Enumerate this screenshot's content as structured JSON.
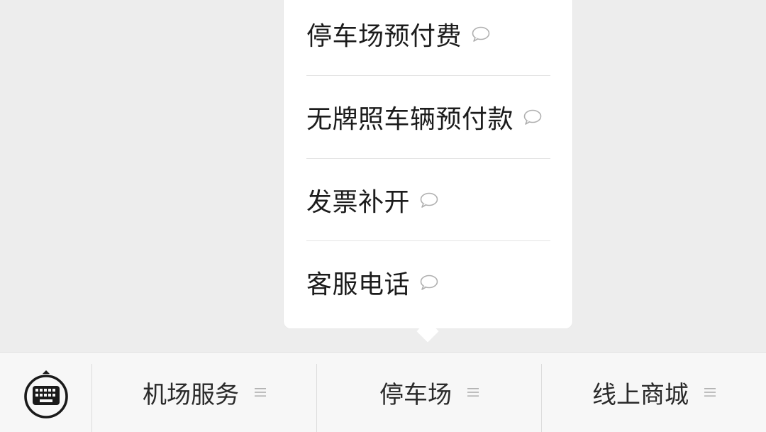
{
  "submenu": {
    "items": [
      {
        "label": "停车场预付费",
        "icon": "chat-bubble-icon"
      },
      {
        "label": "无牌照车辆预付款",
        "icon": "chat-bubble-icon"
      },
      {
        "label": "发票补开",
        "icon": "chat-bubble-icon"
      },
      {
        "label": "客服电话",
        "icon": "chat-bubble-icon"
      }
    ]
  },
  "bottom_bar": {
    "keyboard_icon": "keyboard-icon",
    "menus": [
      {
        "label": "机场服务",
        "icon": "list-menu-icon"
      },
      {
        "label": "停车场",
        "icon": "list-menu-icon"
      },
      {
        "label": "线上商城",
        "icon": "list-menu-icon"
      }
    ]
  },
  "colors": {
    "background": "#ededed",
    "popup": "#ffffff",
    "bar": "#f7f7f7",
    "text": "#1c1c1c",
    "icon": "#b0b0b0"
  }
}
